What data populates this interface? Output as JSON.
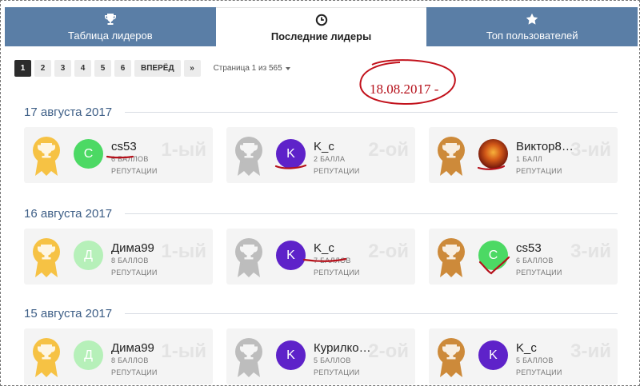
{
  "tabs": [
    {
      "label": "Таблица лидеров",
      "icon": "trophy-icon",
      "active": false
    },
    {
      "label": "Последние лидеры",
      "icon": "clock-icon",
      "active": true
    },
    {
      "label": "Топ пользователей",
      "icon": "star-icon",
      "active": false
    }
  ],
  "pager": {
    "pages": [
      "1",
      "2",
      "3",
      "4",
      "5",
      "6"
    ],
    "active": "1",
    "next_label": "ВПЕРЁД",
    "last_label": "»",
    "page_info": "Страница 1 из 565"
  },
  "annotation": {
    "text": "18.08.2017 -",
    "color": "#b5101a"
  },
  "colors": {
    "tab_bg": "#5a7ea6",
    "gold": "#f6c244",
    "silver": "#bdbdbd",
    "bronze": "#cd8a3a",
    "section_title": "#3d5e86"
  },
  "sections": [
    {
      "date": "17 августа 2017",
      "cards": [
        {
          "name": "cs53",
          "points": "6 БАЛЛОВ",
          "rep": "РЕПУТАЦИИ",
          "place": "1-ый",
          "medal": "gold",
          "avatar_letter": "C",
          "avatar_color": "#4cd964",
          "avatar_type": "letter"
        },
        {
          "name": "K_c",
          "points": "2 БАЛЛА",
          "rep": "РЕПУТАЦИИ",
          "place": "2-ой",
          "medal": "silver",
          "avatar_letter": "K",
          "avatar_color": "#5e22c9",
          "avatar_type": "letter"
        },
        {
          "name": "Виктор8…",
          "points": "1 БАЛЛ",
          "rep": "РЕПУТАЦИИ",
          "place": "3-ий",
          "medal": "bronze",
          "avatar_letter": "",
          "avatar_color": "#a0421a",
          "avatar_type": "photo"
        }
      ]
    },
    {
      "date": "16 августа 2017",
      "cards": [
        {
          "name": "Дима99",
          "points": "8 БАЛЛОВ",
          "rep": "РЕПУТАЦИИ",
          "place": "1-ый",
          "medal": "gold",
          "avatar_letter": "Д",
          "avatar_color": "#b6f0b9",
          "avatar_type": "letter"
        },
        {
          "name": "K_c",
          "points": "7 БАЛЛОВ",
          "rep": "РЕПУТАЦИИ",
          "place": "2-ой",
          "medal": "silver",
          "avatar_letter": "K",
          "avatar_color": "#5e22c9",
          "avatar_type": "letter"
        },
        {
          "name": "cs53",
          "points": "6 БАЛЛОВ",
          "rep": "РЕПУТАЦИИ",
          "place": "3-ий",
          "medal": "bronze",
          "avatar_letter": "C",
          "avatar_color": "#4cd964",
          "avatar_type": "letter"
        }
      ]
    },
    {
      "date": "15 августа 2017",
      "cards": [
        {
          "name": "Дима99",
          "points": "8 БАЛЛОВ",
          "rep": "РЕПУТАЦИИ",
          "place": "1-ый",
          "medal": "gold",
          "avatar_letter": "Д",
          "avatar_color": "#b6f0b9",
          "avatar_type": "letter"
        },
        {
          "name": "Курилко…",
          "points": "5 БАЛЛОВ",
          "rep": "РЕПУТАЦИИ",
          "place": "2-ой",
          "medal": "silver",
          "avatar_letter": "K",
          "avatar_color": "#5e22c9",
          "avatar_type": "letter"
        },
        {
          "name": "K_c",
          "points": "5 БАЛЛОВ",
          "rep": "РЕПУТАЦИИ",
          "place": "3-ий",
          "medal": "bronze",
          "avatar_letter": "K",
          "avatar_color": "#5e22c9",
          "avatar_type": "letter"
        }
      ]
    }
  ]
}
